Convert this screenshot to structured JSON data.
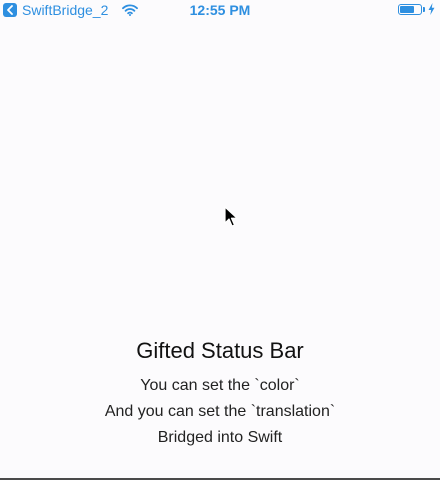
{
  "status_bar": {
    "back_app_label": "SwiftBridge_2",
    "time": "12:55 PM",
    "back_icon": "back-chevron-icon",
    "wifi_icon": "wifi-icon",
    "battery_level": 0.7,
    "charging_icon": "charging-bolt-icon",
    "accent_color": "#2e8fe0"
  },
  "main": {
    "title": "Gifted Status Bar",
    "lines": [
      "You can set the `color`",
      "And you can set the `translation`",
      "Bridged into Swift"
    ]
  },
  "background_color": "#fcfbfd"
}
